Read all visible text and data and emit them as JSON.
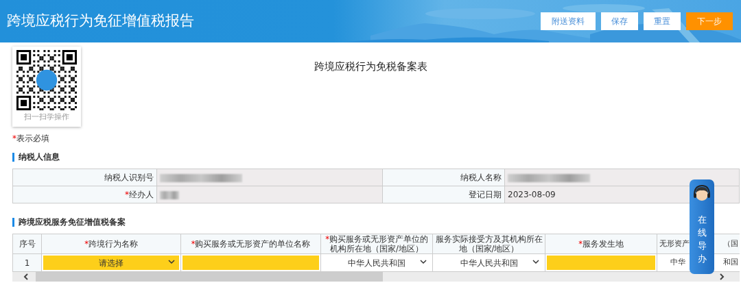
{
  "header": {
    "title": "跨境应税行为免征增值税报告",
    "buttons": [
      {
        "label": "附送资料",
        "kind": "plain"
      },
      {
        "label": "保存",
        "kind": "plain"
      },
      {
        "label": "重置",
        "kind": "plain"
      },
      {
        "label": "下一步",
        "kind": "primary"
      }
    ]
  },
  "qr": {
    "caption": "扫一扫学操作"
  },
  "form_title": "跨境应税行为免税备案表",
  "required_note": {
    "mark": "*",
    "text": "表示必填"
  },
  "taxpayer": {
    "heading": "纳税人信息",
    "rows": [
      [
        {
          "label": "纳税人识别号",
          "required": false,
          "masked": true
        },
        {
          "label": "纳税人名称",
          "required": false,
          "masked": true
        }
      ],
      [
        {
          "label": "经办人",
          "required": true,
          "masked": true
        },
        {
          "label": "登记日期",
          "required": false,
          "masked": false,
          "value": "2023-08-09"
        }
      ]
    ]
  },
  "filing": {
    "heading": "跨境应税服务免征增值税备案",
    "columns": [
      {
        "label": "序号",
        "required": false
      },
      {
        "label": "跨境行为名称",
        "required": true
      },
      {
        "label": "购买服务或无形资产的单位名称",
        "required": true
      },
      {
        "label": "购买服务或无形资产单位的机构所在地（国家/地区）",
        "required": true
      },
      {
        "label": "服务实际接受方及其机构所在地（国家/地区）",
        "required": false
      },
      {
        "label": "服务发生地",
        "required": true
      },
      {
        "label_parts": [
          "无形资产",
          "（国"
        ]
      }
    ],
    "rows": [
      [
        {
          "kind": "text",
          "text": "1"
        },
        {
          "kind": "select",
          "value": "请选择",
          "required": true
        },
        {
          "kind": "input",
          "required": true
        },
        {
          "kind": "select",
          "value": "中华人民共和国",
          "required": false
        },
        {
          "kind": "select",
          "value": "中华人民共和国",
          "required": false
        },
        {
          "kind": "input",
          "required": true
        },
        {
          "kind": "split",
          "parts": [
            "中华",
            "和国"
          ]
        }
      ]
    ]
  },
  "guide": {
    "label": "在线导办"
  }
}
